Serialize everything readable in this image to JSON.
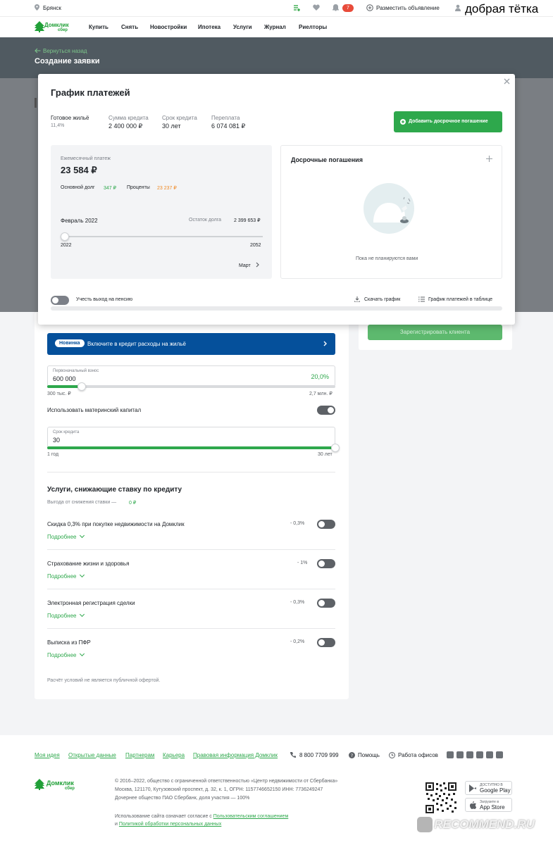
{
  "topbar": {
    "city": "Брянск",
    "notif_count": "7",
    "post_ad": "Разместить объявление",
    "user": "добрая тётка"
  },
  "nav": {
    "logo": "Домклик",
    "logo_sub": "сбер",
    "items": [
      "Купить",
      "Снять",
      "Новостройки",
      "Ипотека",
      "Услуги",
      "Журнал",
      "Риелторы"
    ]
  },
  "header": {
    "back": "Вернуться назад",
    "title": "Создание заявки"
  },
  "modal": {
    "title": "График платежей",
    "summary": [
      {
        "label": "Готовое жильё",
        "value": "11,4%"
      },
      {
        "label": "Сумма кредита",
        "value": "2 400 000 ₽"
      },
      {
        "label": "Срок кредита",
        "value": "30 лет"
      },
      {
        "label": "Переплата",
        "value": "6 074 081 ₽"
      }
    ],
    "add_button": "Добавить досрочное погашение",
    "monthly_label": "Ежемесячный платеж",
    "monthly_value": "23 584 ₽",
    "principal_label": "Основной долг",
    "principal_value": "347 ₽",
    "interest_label": "Проценты",
    "interest_value": "23 237 ₽",
    "month": "Февраль 2022",
    "balance_label": "Остаток долга",
    "balance_value": "2 399 653 ₽",
    "slider_min": "2022",
    "slider_max": "2052",
    "slider_position": 0,
    "next_month": "Март",
    "early_title": "Досрочные погашения",
    "empty_text": "Пока не планируются вами",
    "pension_label": "Учесть выход на пенсию",
    "download": "Скачать график",
    "table": "График платежей в таблице"
  },
  "right": {
    "register_button": "Зарегистрировать клиента"
  },
  "form": {
    "banner_badge": "Новинка",
    "banner_text": "Включите в кредит расходы на жильё",
    "down_label": "Первоначальный взнос",
    "down_value": "600 000",
    "down_percent": "20,0%",
    "down_min": "300 тыс. ₽",
    "down_max": "2,7 млн. ₽",
    "down_fraction": 0.12,
    "maternal": "Использовать материнский капитал",
    "term_label": "Срок кредита",
    "term_value": "30",
    "term_min": "1 год",
    "term_max": "30 лет",
    "term_fraction": 1.0,
    "services_title": "Услуги, снижающие ставку по кредиту",
    "benefit_label": "Выгода от снижения ставки —",
    "benefit_value": "0 ₽",
    "services": [
      {
        "name": "Скидка 0,3% при покупке недвижимости на Домклик",
        "rate": "- 0,3%",
        "more": "Подробнее"
      },
      {
        "name": "Страхование жизни и здоровья",
        "rate": "- 1%",
        "more": "Подробнее"
      },
      {
        "name": "Электронная регистрация сделки",
        "rate": "- 0,3%",
        "more": "Подробнее"
      },
      {
        "name": "Выписка из ПФР",
        "rate": "- 0,2%",
        "more": "Подробнее"
      }
    ],
    "disclaimer": "Расчёт условий не является публичной офертой."
  },
  "footer": {
    "links": [
      "Моя идея",
      "Открытые данные",
      "Партнерам",
      "Карьера",
      "Правовая информация Домклик"
    ],
    "phone": "8 800 7709 999",
    "help": "Помощь",
    "offices": "Работа офисов",
    "logo": "Домклик",
    "logo_sub": "сбер",
    "legal1": "© 2016–2022, общество с ограниченной ответственностью «Центр недвижимости от Сбербанка»",
    "legal2": "Москва, 121170, Кутузовский проспект, д. 32, к. 1, ОГРН: 1157746652150 ИНН: 7736249247",
    "legal3": "Дочернее общество ПАО Сбербанк, доля участия — 100%",
    "consent_prefix": "Использование сайта означает согласие с",
    "consent_link1": "Пользовательским соглашением",
    "and": "и",
    "consent_link2": "Политикой обработки персональных данных",
    "gp_small": "ДОСТУПНО В",
    "gp": "Google Play",
    "as_small": "Загрузите в",
    "as": "App Store"
  },
  "watermark": "RECOMMEND.RU"
}
